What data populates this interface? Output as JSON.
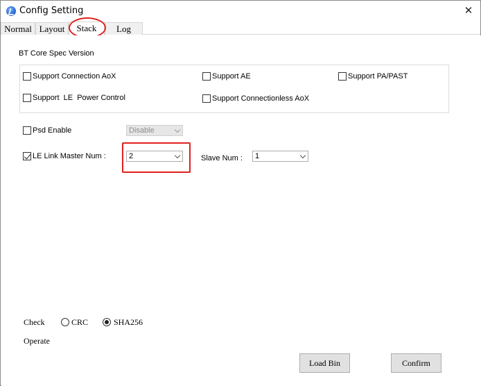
{
  "window": {
    "title": "Config Setting",
    "close_glyph": "✕"
  },
  "tabs": [
    {
      "label": "Normal",
      "active": false
    },
    {
      "label": "Layout",
      "active": false
    },
    {
      "label": "Stack",
      "active": true
    },
    {
      "label": "Log",
      "active": false
    }
  ],
  "stack": {
    "spec_version_label": "BT Core Spec Version",
    "options": {
      "connection_aox": {
        "label": "Support Connection AoX",
        "checked": false
      },
      "ae": {
        "label": "Support AE",
        "checked": false
      },
      "pa_past": {
        "label": "Support PA/PAST",
        "checked": false
      },
      "le_power_control": {
        "label": "Support  LE  Power Control",
        "checked": false
      },
      "connectionless_aox": {
        "label": "Support Connectionless AoX",
        "checked": false
      }
    },
    "psd": {
      "label": "Psd Enable",
      "checked": false,
      "value": "Disable",
      "disabled": true
    },
    "le_link_master": {
      "label": "LE Link Master Num :",
      "checked": true,
      "value": "2"
    },
    "slave": {
      "label": "Slave Num :",
      "value": "1"
    }
  },
  "check": {
    "label": "Check",
    "options": [
      {
        "label": "CRC",
        "selected": false
      },
      {
        "label": "SHA256",
        "selected": true
      }
    ]
  },
  "operate": {
    "label": "Operate",
    "load_bin_label": "Load Bin",
    "confirm_label": "Confirm"
  },
  "annotation": {
    "color": "#e02020"
  }
}
